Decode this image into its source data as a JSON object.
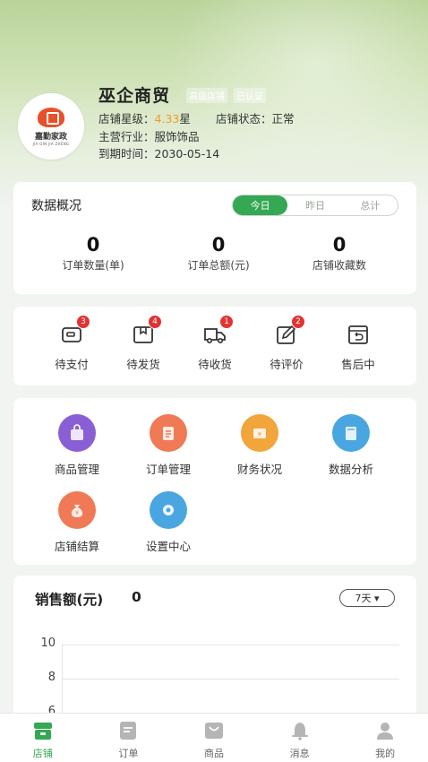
{
  "shop": {
    "name": "巫企商贸",
    "tag_level": "高级店铺",
    "tag_verified": "已认证",
    "rating_label": "店铺星级：",
    "rating_value": "4.33",
    "rating_unit": "星",
    "status_text": "店铺状态：正常",
    "industry_text": "主营行业：服饰饰品",
    "expiry_text": "到期时间：2030-05-14",
    "logo_text": "嘉勤家政",
    "logo_sub": "JIA QIN JIA ZHENG"
  },
  "overview": {
    "title": "数据概况",
    "periods": [
      "今日",
      "昨日",
      "总计"
    ],
    "active_period": "今日",
    "stats": [
      {
        "value": "0",
        "label": "订单数量(单)"
      },
      {
        "value": "0",
        "label": "订单总额(元)"
      },
      {
        "value": "0",
        "label": "店铺收藏数"
      }
    ]
  },
  "orders": [
    {
      "label": "待支付",
      "badge": "3",
      "icon": "wallet-icon"
    },
    {
      "label": "待发货",
      "badge": "4",
      "icon": "package-icon"
    },
    {
      "label": "待收货",
      "badge": "1",
      "icon": "truck-icon"
    },
    {
      "label": "待评价",
      "badge": "2",
      "icon": "edit-icon"
    },
    {
      "label": "售后中",
      "badge": "",
      "icon": "return-box-icon"
    }
  ],
  "tools": [
    {
      "label": "商品管理",
      "icon": "shopping-bag-icon",
      "color": "#8a5fd6"
    },
    {
      "label": "订单管理",
      "icon": "order-list-icon",
      "color": "#ef7a55"
    },
    {
      "label": "财务状况",
      "icon": "finance-icon",
      "color": "#f2a53a"
    },
    {
      "label": "数据分析",
      "icon": "data-analysis-icon",
      "color": "#4aa6e0"
    },
    {
      "label": "店铺结算",
      "icon": "money-bag-icon",
      "color": "#ef7a55"
    },
    {
      "label": "设置中心",
      "icon": "settings-gear-icon",
      "color": "#4aa6e0"
    }
  ],
  "sales": {
    "title": "销售额(元)",
    "value": "0",
    "range": "7天 ▾",
    "yticks": [
      "10",
      "8",
      "6"
    ]
  },
  "tabbar": [
    {
      "label": "店铺",
      "icon": "store-icon",
      "active": true
    },
    {
      "label": "订单",
      "icon": "orders-icon",
      "active": false
    },
    {
      "label": "商品",
      "icon": "goods-icon",
      "active": false
    },
    {
      "label": "消息",
      "icon": "bell-icon",
      "active": false
    },
    {
      "label": "我的",
      "icon": "user-icon",
      "active": false
    }
  ],
  "colors": {
    "accent": "#34a853",
    "badge": "#e23232",
    "highlight": "#f39a1d"
  }
}
